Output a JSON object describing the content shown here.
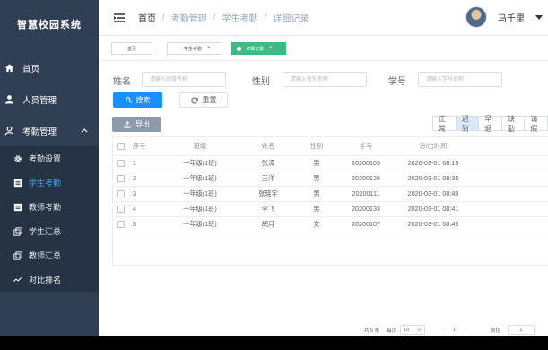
{
  "app": {
    "title": "智慧校园系统"
  },
  "sidebar": {
    "items": [
      {
        "label": "首页",
        "icon": "home-icon"
      },
      {
        "label": "人员管理",
        "icon": "user-icon"
      },
      {
        "label": "考勤管理",
        "icon": "attendance-icon",
        "expanded": true
      }
    ],
    "sub_items": [
      {
        "label": "考勤设置",
        "icon": "gear-icon"
      },
      {
        "label": "学生考勤",
        "icon": "list-icon",
        "active": true
      },
      {
        "label": "教师考勤",
        "icon": "list-icon"
      },
      {
        "label": "学生汇总",
        "icon": "copy-icon"
      },
      {
        "label": "教师汇总",
        "icon": "copy-icon"
      },
      {
        "label": "对比排名",
        "icon": "chart-icon"
      }
    ]
  },
  "header": {
    "breadcrumb": [
      "首页",
      "考勤管理",
      "学生考勤",
      "详细记录"
    ],
    "separator": "/",
    "user_name": "马千里"
  },
  "tags": [
    {
      "label": "首页"
    },
    {
      "label": "学生考勤"
    },
    {
      "label": "详细记录",
      "active": true
    }
  ],
  "filters": {
    "name_label": "姓名",
    "name_placeholder": "请输入班级名称",
    "gender_label": "性别",
    "gender_placeholder": "请输入性别名称",
    "student_no_label": "学号",
    "student_no_placeholder": "请输入学号名称",
    "search_button": "搜索",
    "reset_button": "重置",
    "export_button": "导出"
  },
  "status_tabs": [
    {
      "label": "正常"
    },
    {
      "label": "迟到",
      "active": true
    },
    {
      "label": "早退"
    },
    {
      "label": "缺勤"
    },
    {
      "label": "请假"
    }
  ],
  "table": {
    "columns": [
      "序号",
      "班级",
      "姓名",
      "性别",
      "学号",
      "进/出时间"
    ],
    "rows": [
      {
        "index": "1",
        "class": "一年级(1班)",
        "name": "张涛",
        "gender": "男",
        "student_no": "20200105",
        "time": "2020-03-01 08:15"
      },
      {
        "index": "2",
        "class": "一年级(1班)",
        "name": "王洋",
        "gender": "男",
        "student_no": "20200126",
        "time": "2020-03-01 08:35"
      },
      {
        "index": "3",
        "class": "一年级(1班)",
        "name": "张晓宇",
        "gender": "男",
        "student_no": "20200111",
        "time": "2020-03-01 08:40"
      },
      {
        "index": "4",
        "class": "一年级(1班)",
        "name": "李飞",
        "gender": "男",
        "student_no": "20200133",
        "time": "2020-03-01 08:41"
      },
      {
        "index": "5",
        "class": "一年级(1班)",
        "name": "胡月",
        "gender": "女",
        "student_no": "20200107",
        "time": "2020-03-01 08:45"
      }
    ]
  },
  "pagination": {
    "total_text": "共 5 条",
    "page_size_label": "每页",
    "page_size_value": "10",
    "prev": "‹",
    "current_page": "1",
    "next": "›",
    "goto_label": "前往",
    "goto_value": "1"
  },
  "colors": {
    "sidebar_bg": "#2f3e52",
    "primary": "#1890ff",
    "active_tag": "#42b983",
    "active_menu_text": "#409eff"
  }
}
